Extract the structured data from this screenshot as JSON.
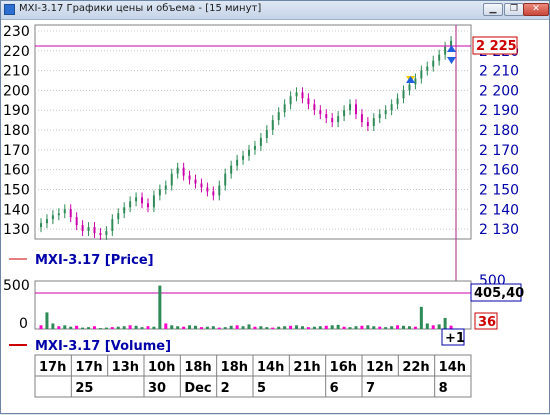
{
  "window": {
    "title": "MXI-3.17 Графики цены и объема - [15 минут]",
    "minimize_icon": "minimize-icon",
    "restore_icon": "restore-icon",
    "close_icon": "close-icon"
  },
  "price_panel": {
    "left_ticks": [
      "230",
      "220",
      "210",
      "200",
      "190",
      "180",
      "170",
      "160",
      "150",
      "140",
      "130"
    ],
    "right_ticks": [
      "2 230",
      "2 220",
      "2 210",
      "2 200",
      "2 190",
      "2 180",
      "2 170",
      "2 160",
      "2 150",
      "2 140",
      "2 130"
    ],
    "current_price_label": "2 225",
    "legend": "MXI-3.17 [Price]",
    "legend_color": "#cc0000",
    "current_price_color": "#cc0000"
  },
  "volume_panel": {
    "left_ticks": [
      "500",
      "0"
    ],
    "right_top_tick": "500",
    "cursor_value": "405,40",
    "last_volume": "36",
    "offset_badge": "+1",
    "legend": "MXI-3.17 [Volume]",
    "legend_color": "#cc0000"
  },
  "time_axis": {
    "hours": [
      "17h",
      "17h",
      "13h",
      "10h",
      "18h",
      "18h",
      "14h",
      "21h",
      "16h",
      "12h",
      "22h",
      "14h"
    ],
    "days": [
      "25",
      "30",
      "Dec",
      "2",
      "5",
      "6",
      "7",
      "8"
    ]
  },
  "colors": {
    "up_candle": "#2e8b57",
    "down_candle": "#cc00aa",
    "axis_text": "#0000aa",
    "grid": "#c8c8c8",
    "volume_up": "#2e8b57",
    "volume_down": "#ff00cc"
  },
  "chart_data": {
    "type": "candlestick",
    "series": [
      {
        "name": "MXI-3.17 [Price]",
        "values": [
          133,
          135,
          137,
          138,
          140,
          136,
          132,
          129,
          131,
          128,
          127,
          129,
          135,
          138,
          141,
          144,
          146,
          143,
          141,
          147,
          150,
          152,
          158,
          161,
          157,
          155,
          153,
          151,
          149,
          147,
          152,
          158,
          162,
          165,
          167,
          170,
          172,
          176,
          180,
          185,
          189,
          193,
          197,
          199,
          196,
          193,
          190,
          188,
          186,
          184,
          187,
          190,
          193,
          188,
          184,
          182,
          186,
          188,
          190,
          193,
          196,
          200,
          203,
          206,
          210,
          212,
          215,
          218,
          222,
          225
        ]
      },
      {
        "name": "MXI-3.17 [Volume]",
        "values": [
          40,
          180,
          60,
          30,
          40,
          25,
          35,
          15,
          20,
          30,
          10,
          15,
          20,
          25,
          30,
          40,
          35,
          20,
          30,
          25,
          470,
          60,
          40,
          30,
          25,
          40,
          35,
          20,
          25,
          30,
          15,
          20,
          35,
          40,
          30,
          50,
          25,
          30,
          20,
          15,
          25,
          30,
          35,
          40,
          30,
          20,
          25,
          30,
          35,
          40,
          45,
          25,
          20,
          30,
          35,
          40,
          30,
          25,
          20,
          30,
          40,
          35,
          30,
          25,
          240,
          60,
          40,
          50,
          120,
          36
        ]
      }
    ],
    "price_ylim": [
      125,
      233
    ],
    "volume_ylim": [
      0,
      520
    ],
    "grid": true
  }
}
